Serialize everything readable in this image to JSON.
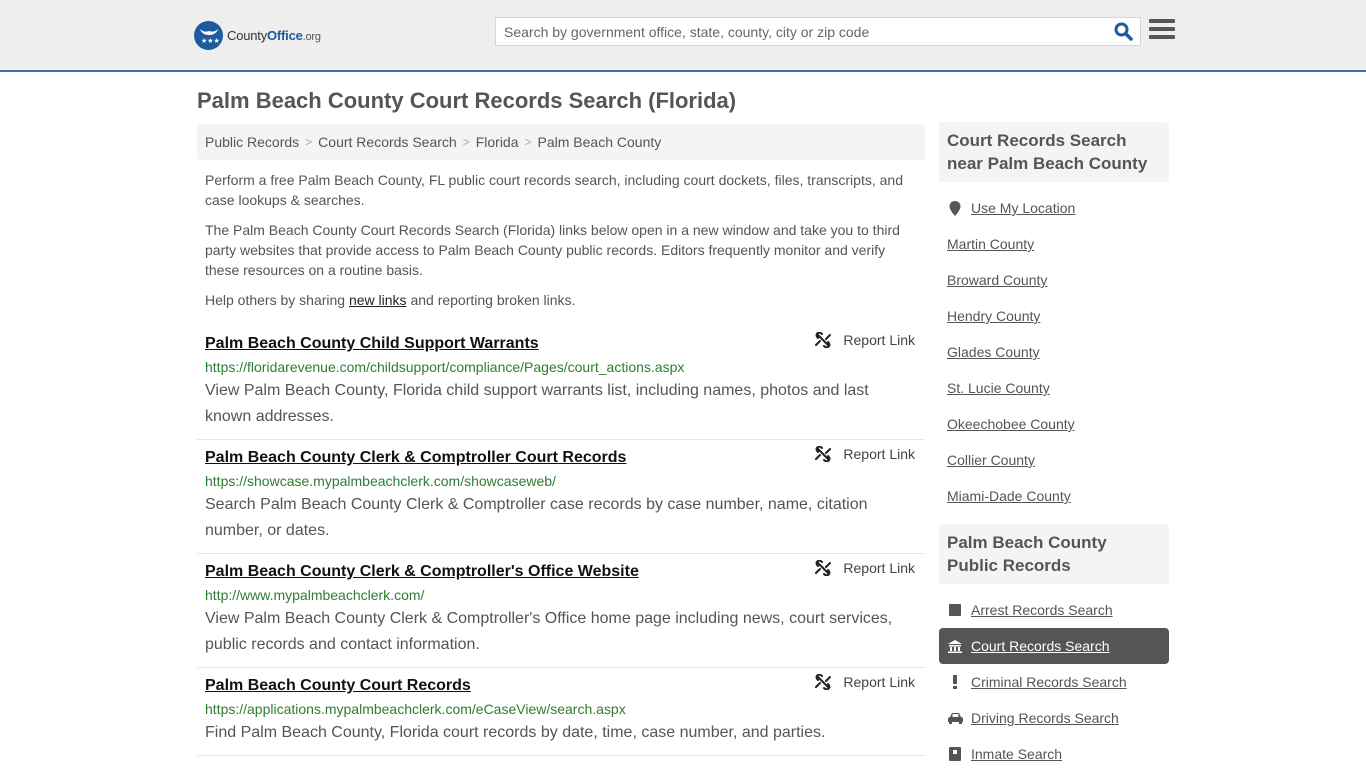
{
  "header": {
    "logo": {
      "brand_county": "County",
      "brand_office": "Office",
      "brand_tld": ".org"
    },
    "search": {
      "placeholder": "Search by government office, state, county, city or zip code",
      "value": ""
    },
    "colors": {
      "brand_blue": "#1e5aa0",
      "header_border": "#3a77a8",
      "url_green": "#2e7d32"
    }
  },
  "page": {
    "title": "Palm Beach County Court Records Search (Florida)",
    "breadcrumb": [
      "Public Records",
      "Court Records Search",
      "Florida",
      "Palm Beach County"
    ],
    "intro": {
      "p1": "Perform a free Palm Beach County, FL public court records search, including court dockets, files, transcripts, and case lookups & searches.",
      "p2": "The Palm Beach County Court Records Search (Florida) links below open in a new window and take you to third party websites that provide access to Palm Beach County public records. Editors frequently monitor and verify these resources on a routine basis.",
      "p3_before": "Help others by sharing ",
      "p3_link": "new links",
      "p3_after": " and reporting broken links."
    }
  },
  "results": [
    {
      "title": "Palm Beach County Child Support Warrants",
      "url": "https://floridarevenue.com/childsupport/compliance/Pages/court_actions.aspx",
      "description": "View Palm Beach County, Florida child support warrants list, including names, photos and last known addresses.",
      "report_label": "Report Link"
    },
    {
      "title": "Palm Beach County Clerk & Comptroller Court Records",
      "url": "https://showcase.mypalmbeachclerk.com/showcaseweb/",
      "description": "Search Palm Beach County Clerk & Comptroller case records by case number, name, citation number, or dates.",
      "report_label": "Report Link"
    },
    {
      "title": "Palm Beach County Clerk & Comptroller's Office Website",
      "url": "http://www.mypalmbeachclerk.com/",
      "description": "View Palm Beach County Clerk & Comptroller's Office home page including news, court services, public records and contact information.",
      "report_label": "Report Link"
    },
    {
      "title": "Palm Beach County Court Records",
      "url": "https://applications.mypalmbeachclerk.com/eCaseView/search.aspx",
      "description": "Find Palm Beach County, Florida court records by date, time, case number, and parties.",
      "report_label": "Report Link"
    }
  ],
  "sidebar": {
    "nearby": {
      "heading": "Court Records Search near Palm Beach County",
      "use_location": {
        "label": "Use My Location",
        "icon": "map-marker-icon"
      },
      "counties": [
        "Martin County",
        "Broward County",
        "Hendry County",
        "Glades County",
        "St. Lucie County",
        "Okeechobee County",
        "Collier County",
        "Miami-Dade County"
      ]
    },
    "public_records": {
      "heading": "Palm Beach County Public Records",
      "items": [
        {
          "label": "Arrest Records Search",
          "icon": "square-icon",
          "active": false
        },
        {
          "label": "Court Records Search",
          "icon": "courthouse-icon",
          "active": true
        },
        {
          "label": "Criminal Records Search",
          "icon": "exclamation-icon",
          "active": false
        },
        {
          "label": "Driving Records Search",
          "icon": "car-icon",
          "active": false
        },
        {
          "label": "Inmate Search",
          "icon": "inmate-icon",
          "active": false
        }
      ]
    }
  }
}
